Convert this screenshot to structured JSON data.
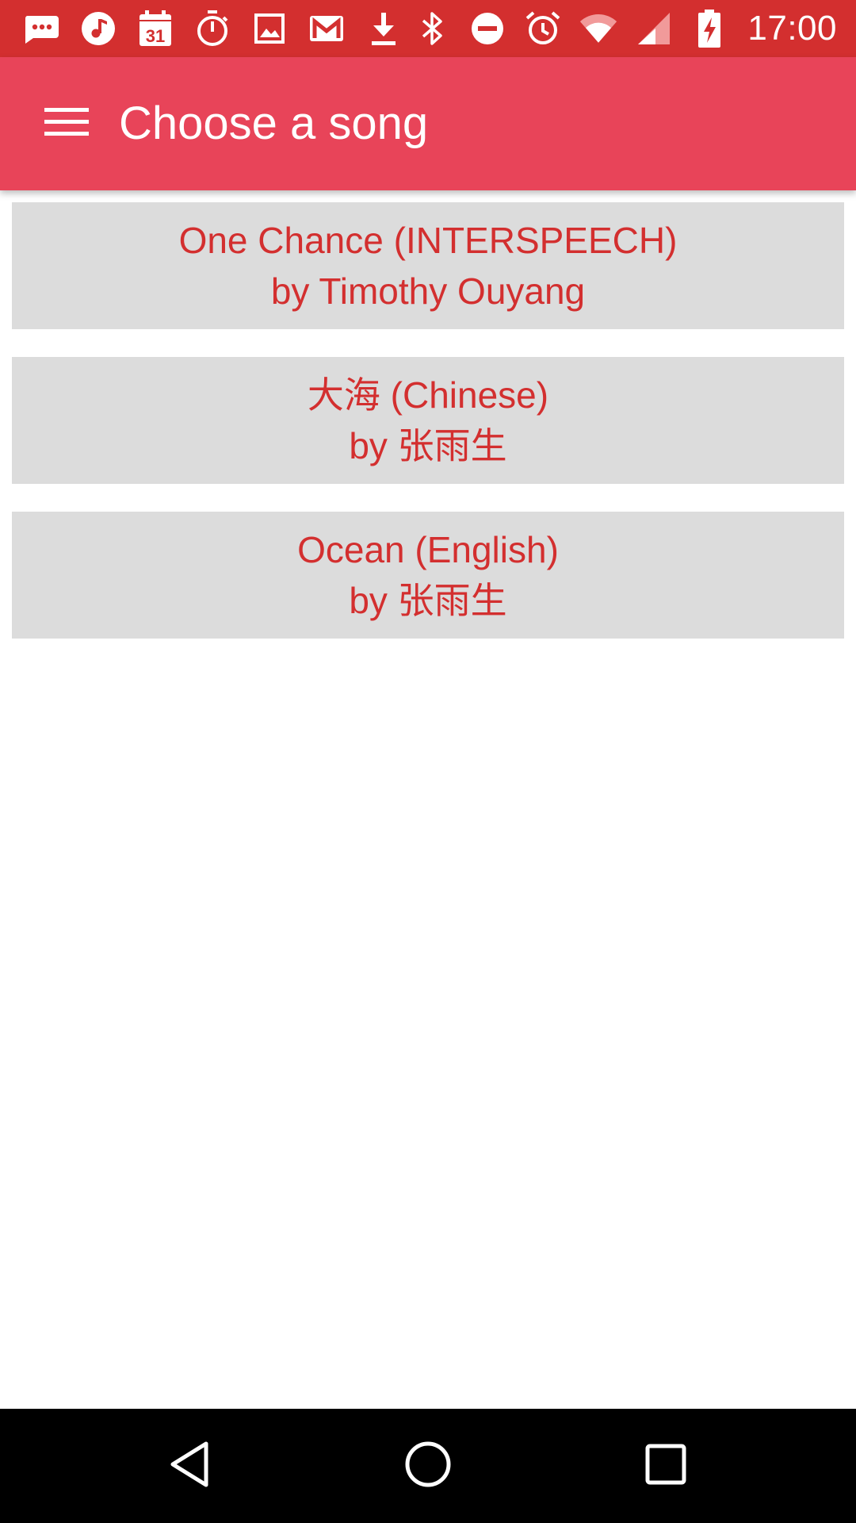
{
  "status_bar": {
    "time": "17:00",
    "background_color": "#d32f2f",
    "left_icons": [
      "messages-icon",
      "music-note-icon",
      "calendar-icon",
      "stopwatch-icon",
      "image-icon",
      "gmail-icon",
      "download-icon"
    ],
    "calendar_day": "31",
    "right_icons": [
      "bluetooth-icon",
      "do-not-disturb-icon",
      "alarm-icon",
      "wifi-icon",
      "cell-signal-icon",
      "battery-charging-icon"
    ]
  },
  "app_bar": {
    "title": "Choose a song",
    "menu_icon": "hamburger-menu-icon",
    "background_color": "#e84459"
  },
  "songs": [
    {
      "title": "One Chance (INTERSPEECH)",
      "artist": "by Timothy Ouyang"
    },
    {
      "title": "大海 (Chinese)",
      "artist": "by 张雨生"
    },
    {
      "title": "Ocean (English)",
      "artist": "by 张雨生"
    }
  ],
  "song_text_color": "#d32f2f",
  "song_item_background": "#dcdcdc",
  "nav_bar": {
    "buttons": [
      "back-icon",
      "home-icon",
      "recents-icon"
    ],
    "background_color": "#000000"
  }
}
